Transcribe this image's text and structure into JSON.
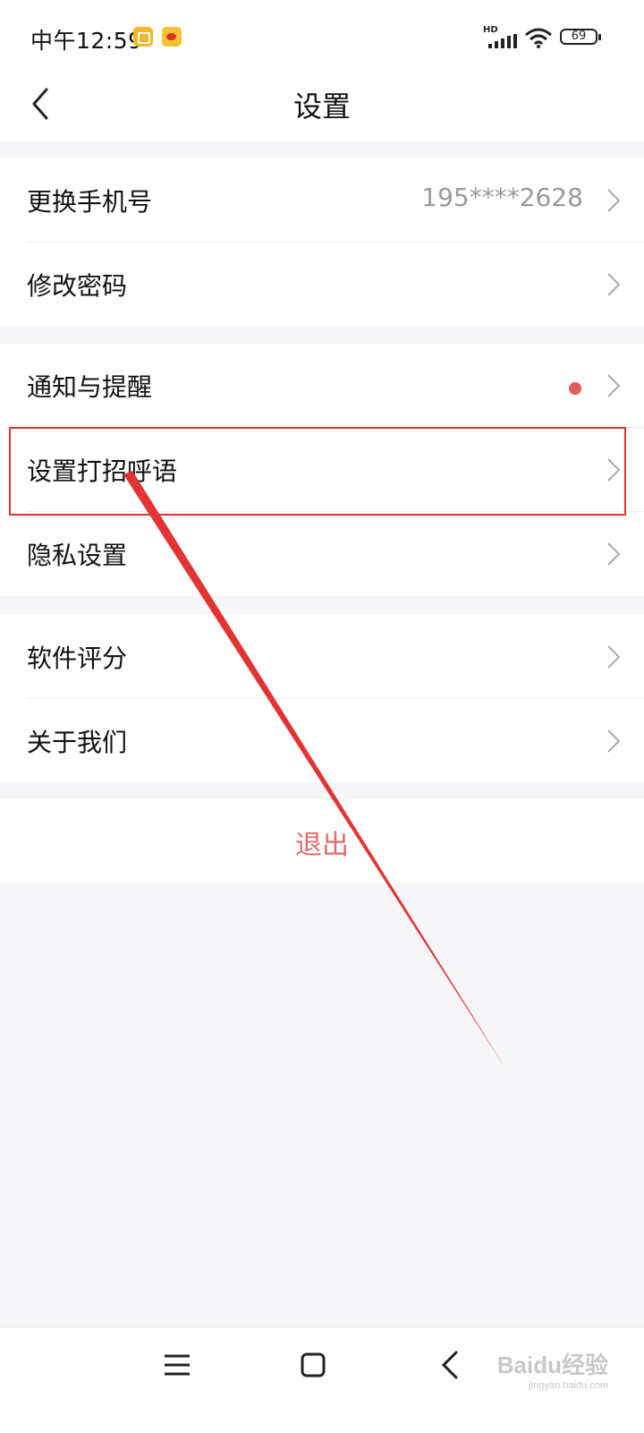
{
  "status_bar": {
    "time": "中午12:59",
    "network": "HD",
    "battery": "69"
  },
  "header": {
    "title": "设置"
  },
  "groups": [
    {
      "items": [
        {
          "label": "更换手机号",
          "value": "195****2628"
        },
        {
          "label": "修改密码"
        }
      ]
    },
    {
      "items": [
        {
          "label": "通知与提醒",
          "badge": "red-dot"
        },
        {
          "label": "设置打招呼语"
        },
        {
          "label": "隐私设置"
        }
      ]
    },
    {
      "items": [
        {
          "label": "软件评分"
        },
        {
          "label": "关于我们"
        }
      ]
    }
  ],
  "logout": {
    "label": "退出"
  },
  "watermark": {
    "main": "Baidu经验",
    "sub": "jingyan.baidu.com"
  },
  "colors": {
    "background": "#f6f6f8",
    "logout_text": "#e26a6a",
    "highlight": "#e33434",
    "badge": "#e25c5c"
  }
}
